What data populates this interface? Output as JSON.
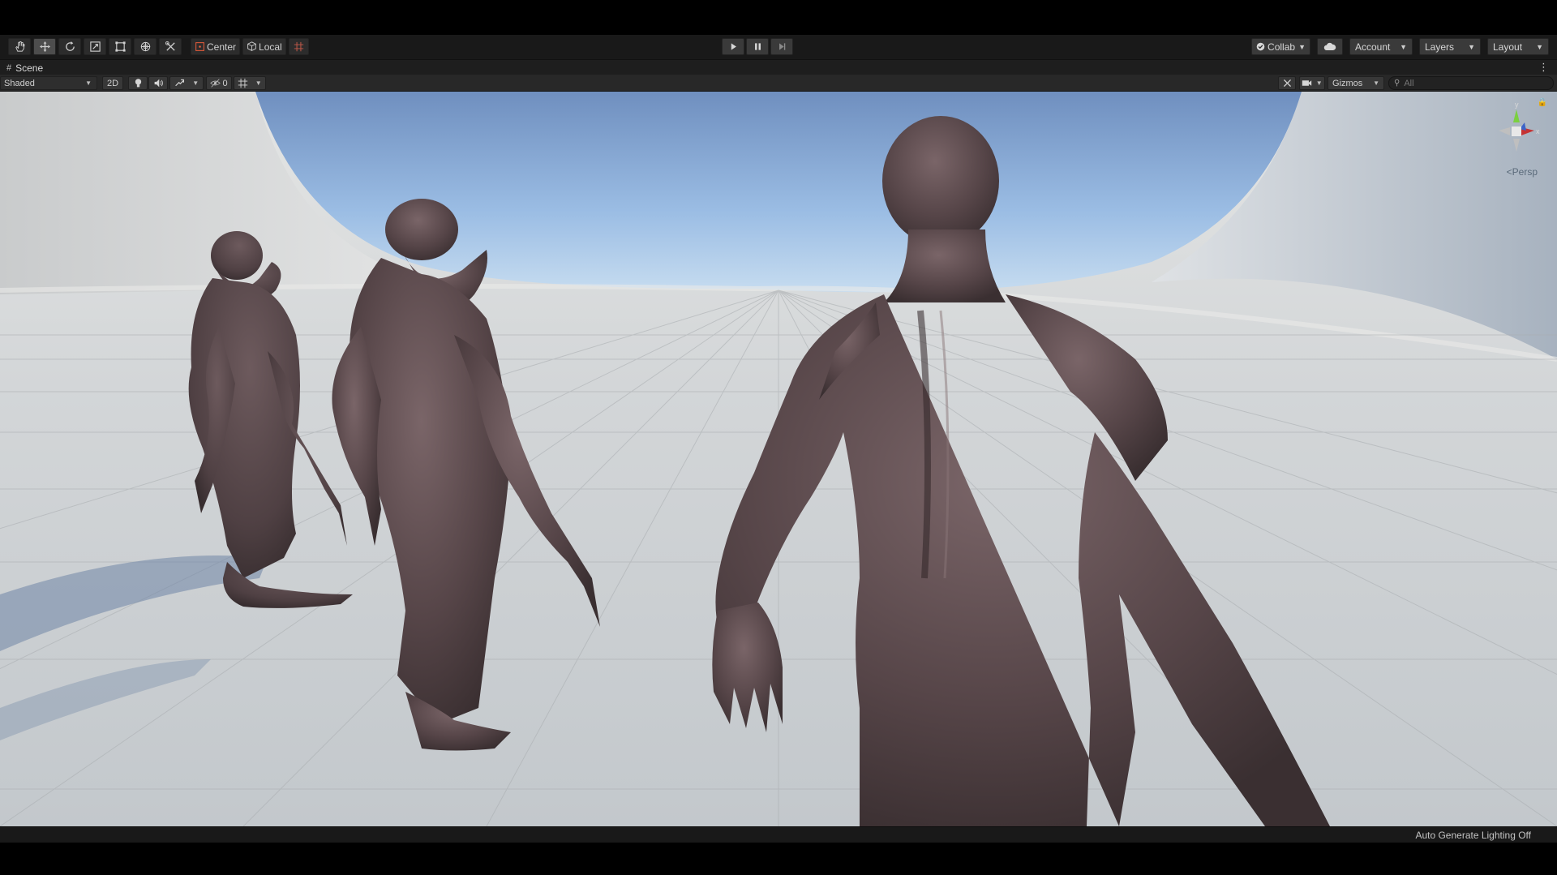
{
  "toolbar": {
    "tools": [
      {
        "name": "hand-tool-icon"
      },
      {
        "name": "move-tool-icon"
      },
      {
        "name": "rotate-tool-icon"
      },
      {
        "name": "scale-tool-icon"
      },
      {
        "name": "rect-tool-icon"
      },
      {
        "name": "transform-tool-icon"
      },
      {
        "name": "custom-tool-icon"
      }
    ],
    "pivot_mode": "Center",
    "pivot_rotation": "Local",
    "collab_label": "Collab",
    "account_label": "Account",
    "layers_label": "Layers",
    "layout_label": "Layout"
  },
  "scene_tab": {
    "label": "Scene"
  },
  "scene_toolbar": {
    "draw_mode": "Shaded",
    "mode_2d": "2D",
    "hidden_count": "0",
    "gizmos_label": "Gizmos",
    "search_placeholder": "All"
  },
  "viewport": {
    "projection_label": "Persp",
    "axis_labels": {
      "y": "y",
      "x": "x"
    }
  },
  "status": {
    "lighting_text": "Auto Generate Lighting Off"
  },
  "colors": {
    "toolbar_bg": "#191919",
    "sky_top": "#7595c4",
    "sky_bottom": "#b9d4ee",
    "ground": "#c9cdd0",
    "creature_skin": "#5b4a4c"
  }
}
